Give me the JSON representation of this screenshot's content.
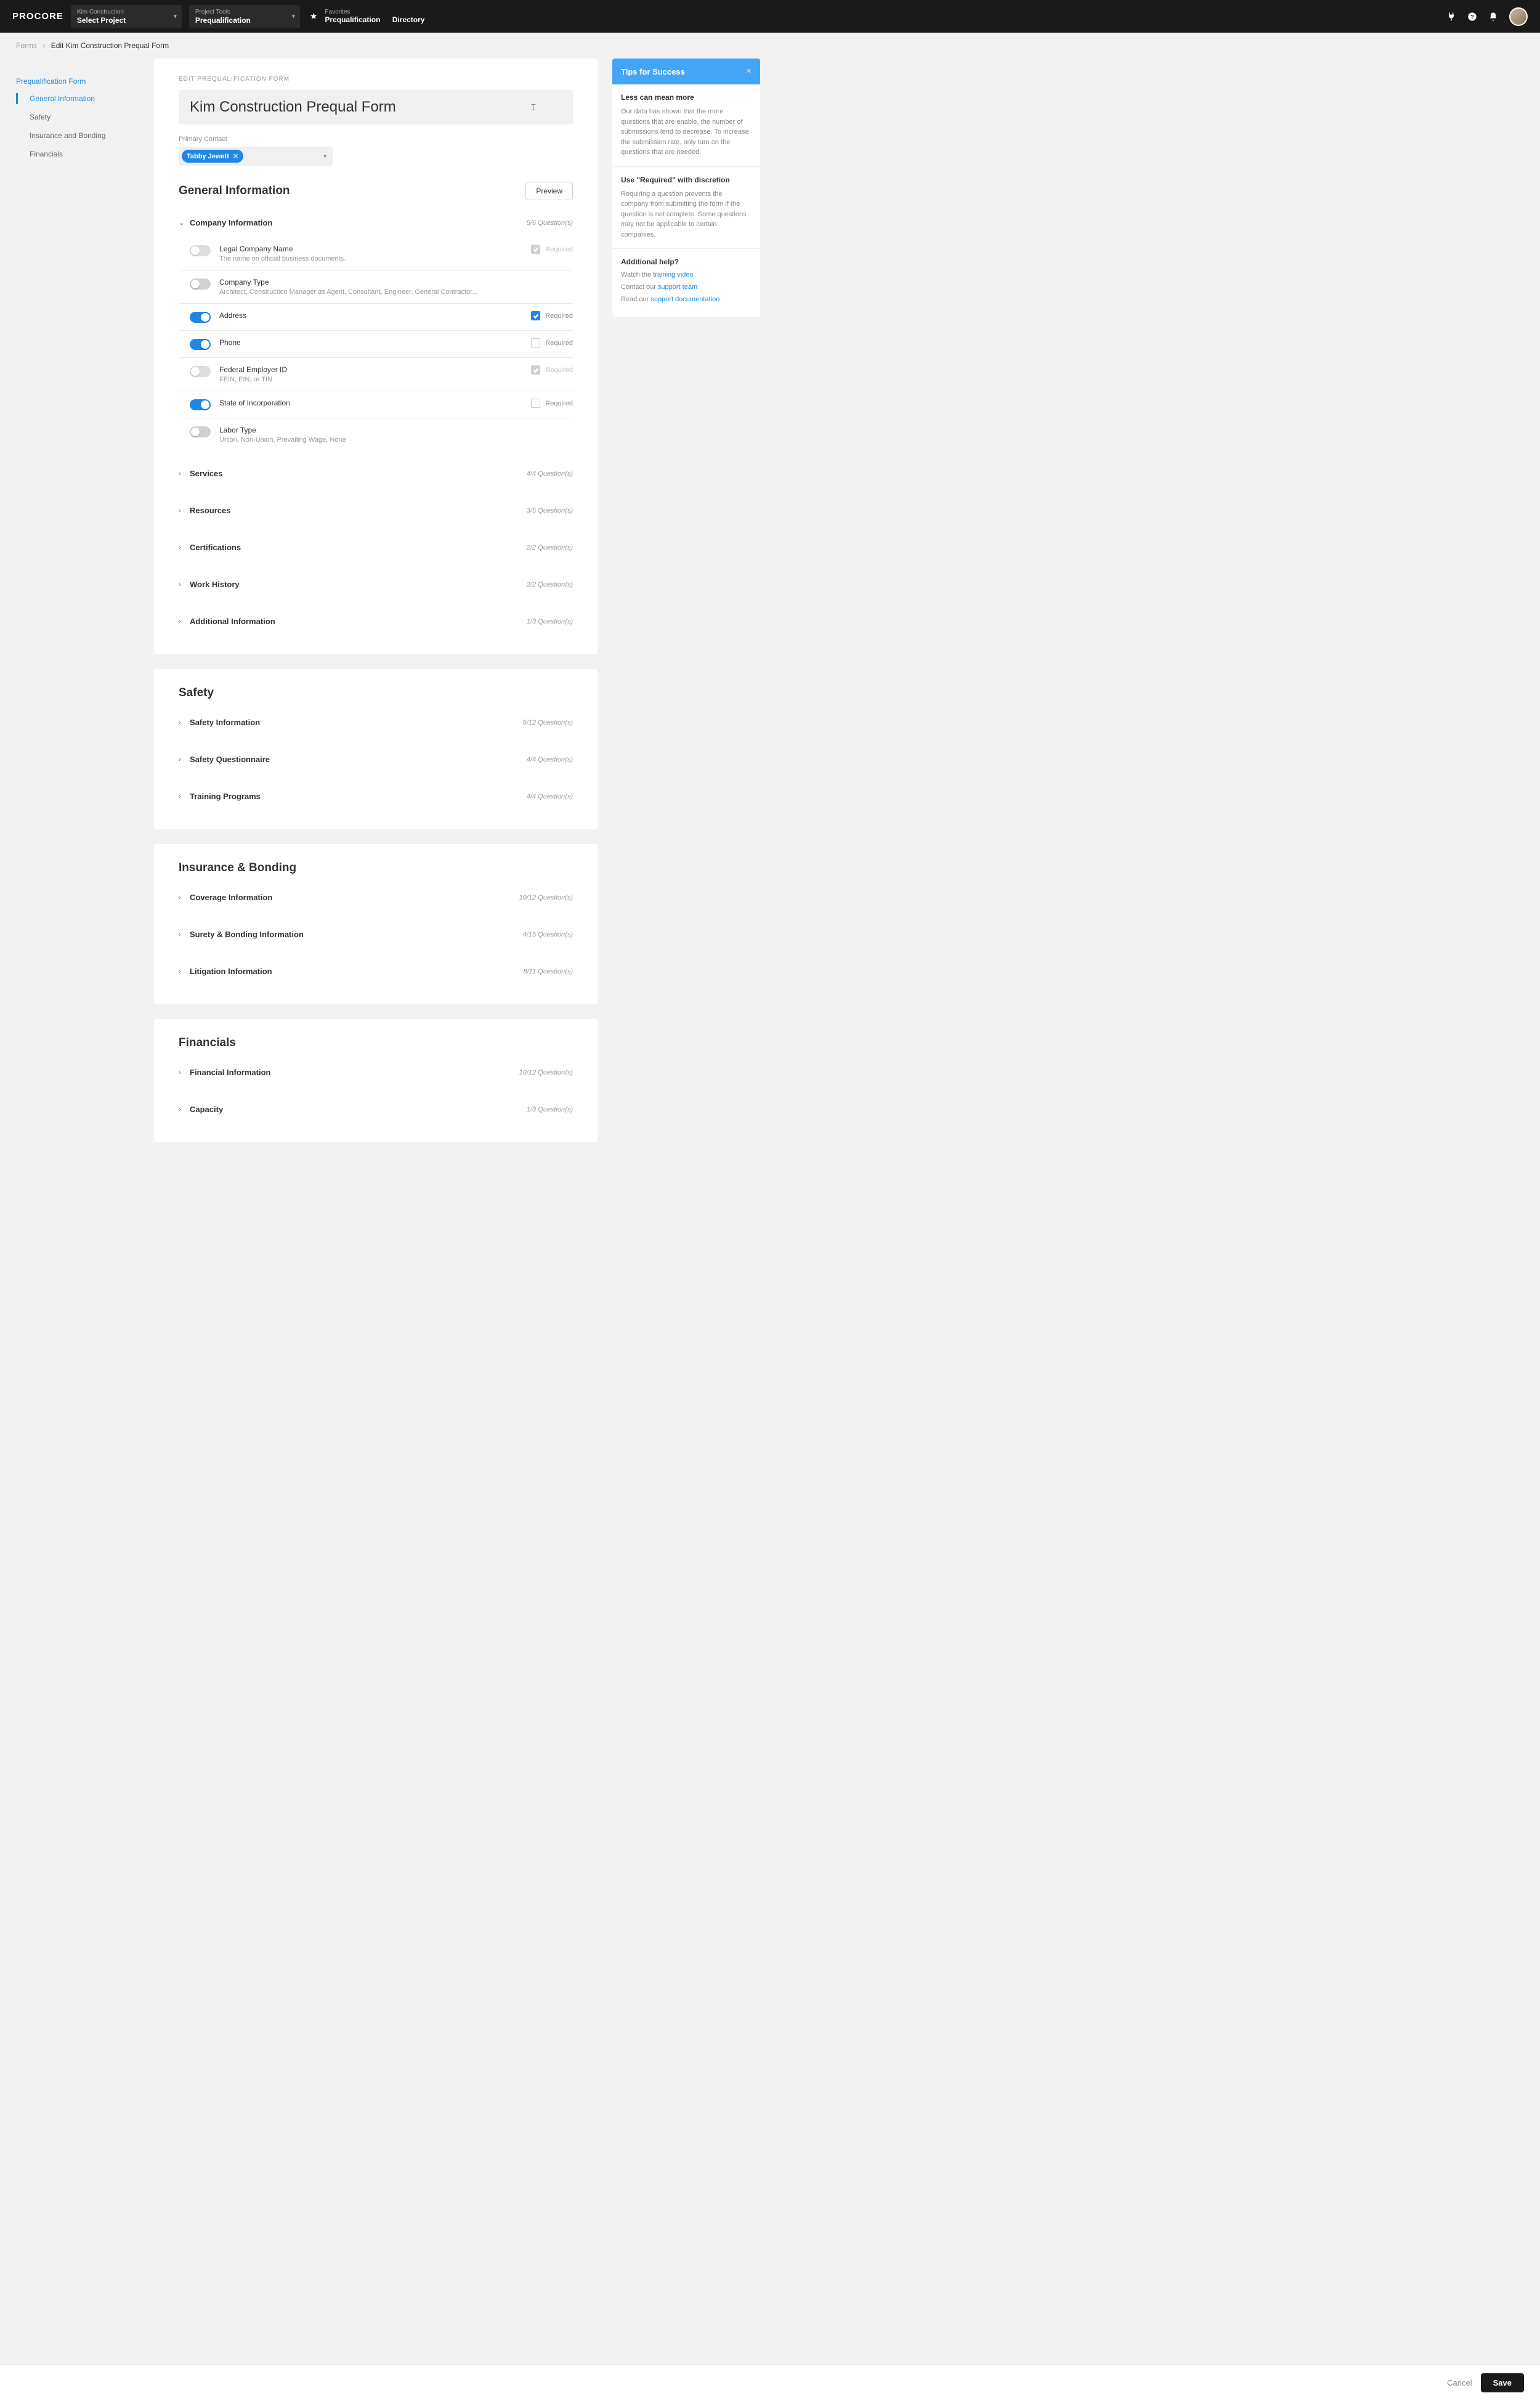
{
  "topbar": {
    "logo": "PROCORE",
    "dd1_l1": "Kim Construction",
    "dd1_l2": "Select Project",
    "dd2_l1": "Project Tools",
    "dd2_l2": "Prequalification",
    "fav_label": "Favorites",
    "fav_link1": "Prequalification",
    "fav_link2": "Directory"
  },
  "crumb": {
    "c1": "Forms",
    "c2": "Edit Kim Construction Prequal Form"
  },
  "sidenav": {
    "top": "Prequalification Form",
    "items": [
      "General Information",
      "Safety",
      "Insurance and Bonding",
      "Financials"
    ]
  },
  "edit_label": "EDIT PREQUALIFICATION FORM",
  "form_title": "Kim Construction Prequal Form",
  "primary_contact_label": "Primary Contact",
  "primary_contact_chip": "Tabby Jewett",
  "preview_btn": "Preview",
  "required_label": "Required",
  "question_suffix": " Question(s)",
  "sections": {
    "general": {
      "title": "General Information",
      "groups": [
        {
          "title": "Company Information",
          "count": "5/6",
          "open": true,
          "questions": [
            {
              "title": "Legal Company Name",
              "sub": "The name on official business documents.",
              "on": false,
              "locked": true,
              "req": true,
              "req_locked": true
            },
            {
              "title": "Company Type",
              "sub": "Architect, Construction Manager as Agent, Consultant, Engineer, General Contractor...",
              "on": false,
              "locked": false,
              "req": null
            },
            {
              "title": "Address",
              "sub": "",
              "on": true,
              "locked": false,
              "req": true,
              "req_locked": false
            },
            {
              "title": "Phone",
              "sub": "",
              "on": true,
              "locked": false,
              "req": false,
              "req_locked": false
            },
            {
              "title": "Federal Employer ID",
              "sub": "FEIN, EIN, or TIN",
              "on": false,
              "locked": true,
              "req": true,
              "req_locked": true
            },
            {
              "title": "State of Incorporation",
              "sub": "",
              "on": true,
              "locked": false,
              "req": false,
              "req_locked": false
            },
            {
              "title": "Labor Type",
              "sub": "Union, Non-Union, Prevailing Wage, None",
              "on": false,
              "locked": false,
              "req": null
            }
          ]
        },
        {
          "title": "Services",
          "count": "4/4"
        },
        {
          "title": "Resources",
          "count": "3/5"
        },
        {
          "title": "Certifications",
          "count": "2/2"
        },
        {
          "title": "Work History",
          "count": "2/2"
        },
        {
          "title": "Additional Information",
          "count": "1/3"
        }
      ]
    },
    "safety": {
      "title": "Safety",
      "groups": [
        {
          "title": "Safety Information",
          "count": "5/12"
        },
        {
          "title": "Safety Questionnaire",
          "count": "4/4"
        },
        {
          "title": "Training Programs",
          "count": "4/4"
        }
      ]
    },
    "insurance": {
      "title": "Insurance & Bonding",
      "groups": [
        {
          "title": "Coverage Information",
          "count": "10/12"
        },
        {
          "title": "Surety & Bonding Information",
          "count": "4/15"
        },
        {
          "title": "Litigation Information",
          "count": "8/11"
        }
      ]
    },
    "financials": {
      "title": "Financials",
      "groups": [
        {
          "title": "Financial Information",
          "count": "10/12"
        },
        {
          "title": "Capacity",
          "count": "1/3"
        }
      ]
    }
  },
  "tips": {
    "head": "Tips for Success",
    "s1_h": "Less can mean more",
    "s1_p": "Our data has shown that the more questions that are enable, the number of submissions tend to decrease. To increase the submission rate, only turn on the questions that are needed.",
    "s2_h": "Use \"Required\" with discretion",
    "s2_p": "Requiring a question prevents the company from submitting the form if the question is not complete. Some questions may not be applicable to certain companies.",
    "s3_h": "Additional help?",
    "s3_l1_pre": "Watch the ",
    "s3_l1_link": "training video",
    "s3_l2_pre": "Contact our ",
    "s3_l2_link": "support team",
    "s3_l3_pre": "Read our ",
    "s3_l3_link": "support documentation"
  },
  "footer": {
    "cancel": "Cancel",
    "save": "Save"
  }
}
